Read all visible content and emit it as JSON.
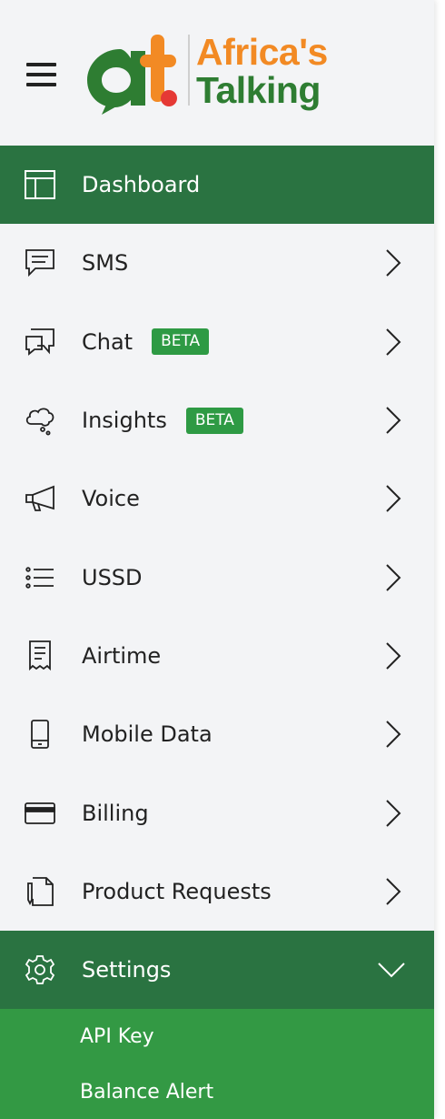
{
  "brand": {
    "line1": "Africa's",
    "line2": "Talking",
    "mark_colors": {
      "green": "#2e7d32",
      "orange": "#f28a24",
      "red": "#e53935"
    }
  },
  "nav": {
    "items": [
      {
        "label": "Dashboard",
        "icon": "layout-icon",
        "active": true
      },
      {
        "label": "SMS",
        "icon": "message-icon"
      },
      {
        "label": "Chat",
        "icon": "chat-icon",
        "badge": "BETA"
      },
      {
        "label": "Insights",
        "icon": "thought-cloud-icon",
        "badge": "BETA"
      },
      {
        "label": "Voice",
        "icon": "megaphone-icon"
      },
      {
        "label": "USSD",
        "icon": "list-icon"
      },
      {
        "label": "Airtime",
        "icon": "receipt-icon"
      },
      {
        "label": "Mobile Data",
        "icon": "phone-icon"
      },
      {
        "label": "Billing",
        "icon": "card-icon"
      },
      {
        "label": "Product Requests",
        "icon": "document-pen-icon"
      },
      {
        "label": "Settings",
        "icon": "gear-icon",
        "active": true,
        "expanded": true
      }
    ],
    "settings_sub": [
      "API Key",
      "Balance Alert"
    ]
  },
  "colors": {
    "active_bg": "#2a7341",
    "sub_bg": "#339944",
    "badge_bg": "#2e9a44",
    "sidebar_bg": "#f3f4f6"
  }
}
